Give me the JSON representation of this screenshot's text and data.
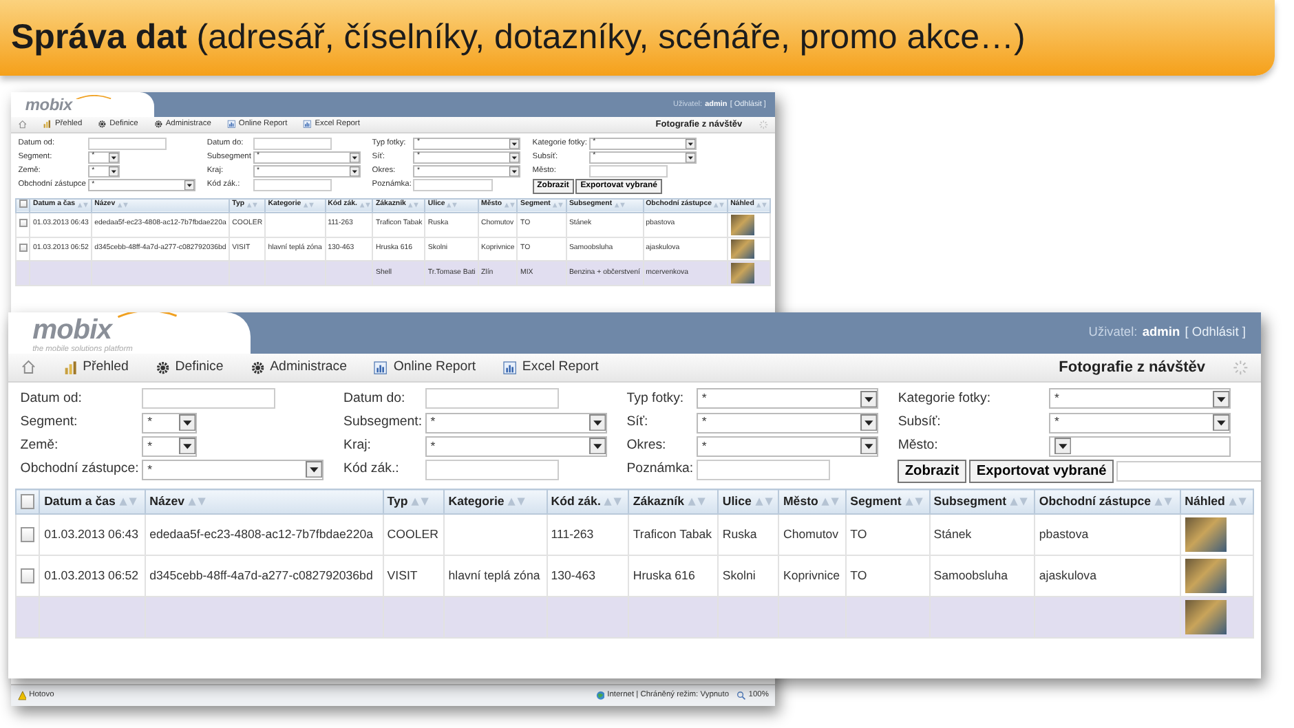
{
  "slide_title": "**Správa dat** (adresář, číselníky, dotazníky, scénáře, promo akce…)",
  "back_screenshot": {
    "logo": "mobix",
    "user_label": "Uživatel:",
    "user_name": "admin",
    "logout": "[ Odhlásit ]",
    "nav": [
      {
        "kind": "home"
      },
      {
        "kind": "chart",
        "label": "Přehled"
      },
      {
        "kind": "gear",
        "label": "Definice"
      },
      {
        "kind": "gear",
        "label": "Administrace"
      },
      {
        "kind": "report",
        "label": "Online Report"
      },
      {
        "kind": "report",
        "label": "Excel Report"
      }
    ],
    "page_title": "Fotografie z návštěv",
    "filter_columns": [
      {
        "items": [
          {
            "kind": "text",
            "label": "Datum od:"
          },
          {
            "kind": "short_select",
            "label": "Segment:",
            "value": "*"
          },
          {
            "kind": "short_select",
            "label": "Země:",
            "value": "*"
          },
          {
            "kind": "select",
            "label": "Obchodní zástupce",
            "value": "*"
          }
        ]
      },
      {
        "items": [
          {
            "kind": "text",
            "label": "Datum do:"
          },
          {
            "kind": "select",
            "label": "Subsegment",
            "value": "*"
          },
          {
            "kind": "select",
            "label": "Kraj:",
            "value": "*"
          },
          {
            "kind": "text",
            "label": "Kód zák.:"
          }
        ]
      },
      {
        "items": [
          {
            "kind": "select",
            "label": "Typ fotky:",
            "value": "*"
          },
          {
            "kind": "select",
            "label": "Síť:",
            "value": "*"
          },
          {
            "kind": "select",
            "label": "Okres:",
            "value": "*"
          },
          {
            "kind": "text",
            "label": "Poznámka:"
          }
        ]
      },
      {
        "items": [
          {
            "kind": "select",
            "label": "Kategorie fotky:",
            "value": "*"
          },
          {
            "kind": "select",
            "label": "Subsíť:",
            "value": "*"
          },
          {
            "kind": "text",
            "label": "Město:"
          },
          {
            "kind": "buttons"
          }
        ]
      }
    ],
    "buttons": [
      "Zobrazit",
      "Exportovat vybrané"
    ],
    "select_all_checked": false,
    "columns": [
      "Datum a čas",
      "Název",
      "Typ",
      "Kategorie",
      "Kód zák.",
      "Zákazník",
      "Ulice",
      "Město",
      "Segment",
      "Subsegment",
      "Obchodní zástupce",
      "Náhled"
    ],
    "rows": [
      {
        "checked": false,
        "highlighted": false,
        "cells": [
          "01.03.2013 06:43",
          "ededaa5f-ec23-4808-ac12-7b7fbdae220a",
          "COOLER",
          null,
          "111-263",
          "Traficon Tabak",
          "Ruska",
          "Chomutov",
          "TO",
          "Stánek",
          "pbastova"
        ]
      },
      {
        "checked": false,
        "highlighted": false,
        "cells": [
          "01.03.2013 06:52",
          "d345cebb-48ff-4a7d-a277-c082792036bd",
          "VISIT",
          "hlavní teplá zóna",
          "130-463",
          "Hruska 616",
          "Skolni",
          "Koprivnice",
          "TO",
          "Samoobsluha",
          "ajaskulova"
        ]
      },
      {
        "checked": null,
        "highlighted": true,
        "cells": [
          null,
          null,
          null,
          null,
          null,
          "Shell",
          "Tr.Tomase Bati",
          "Zlín",
          "MIX",
          "Benzina + občerstvení",
          "mcervenkova"
        ]
      }
    ],
    "status_bar": {
      "left": "Hotovo",
      "zone": "Internet | Chráněný režim: Vypnuto",
      "zoom": "100%"
    }
  },
  "front_screenshot": {
    "logo": "mobix",
    "tagline": "the mobile solutions platform",
    "user_label": "Uživatel:",
    "user_name": "admin",
    "logout": "[ Odhlásit ]",
    "nav": [
      {
        "kind": "home"
      },
      {
        "kind": "chart",
        "label": "Přehled"
      },
      {
        "kind": "gear",
        "label": "Definice"
      },
      {
        "kind": "gear",
        "label": "Administrace"
      },
      {
        "kind": "report",
        "label": "Online Report"
      },
      {
        "kind": "report",
        "label": "Excel Report"
      }
    ],
    "page_title": "Fotografie z návštěv",
    "filter_columns": [
      {
        "items": [
          {
            "kind": "text",
            "label": "Datum od:"
          },
          {
            "kind": "short_select",
            "label": "Segment:",
            "value": "*"
          },
          {
            "kind": "short_select",
            "label": "Země:",
            "value": "*"
          },
          {
            "kind": "select",
            "label": "Obchodní zástupce:",
            "value": "*"
          }
        ]
      },
      {
        "items": [
          {
            "kind": "text",
            "label": "Datum do:"
          },
          {
            "kind": "select",
            "label": "Subsegment:",
            "value": "*"
          },
          {
            "kind": "select",
            "label": "Kraj:",
            "value": "*"
          },
          {
            "kind": "text",
            "label": "Kód zák.:"
          }
        ]
      },
      {
        "items": [
          {
            "kind": "select",
            "label": "Typ fotky:",
            "value": "*"
          },
          {
            "kind": "select",
            "label": "Síť:",
            "value": "*"
          },
          {
            "kind": "select",
            "label": "Okres:",
            "value": "*"
          },
          {
            "kind": "text",
            "label": "Poznámka:"
          }
        ]
      },
      {
        "items": [
          {
            "kind": "select",
            "label": "Kategorie fotky:",
            "value": "*"
          },
          {
            "kind": "select",
            "label": "Subsíť:",
            "value": "*"
          },
          {
            "kind": "select",
            "label": "Město:"
          },
          {
            "kind": "buttons",
            "with_field": true
          }
        ]
      }
    ],
    "buttons": [
      "Zobrazit",
      "Exportovat vybrané"
    ],
    "select_all_checked": false,
    "columns": [
      "Datum a čas",
      "Název",
      "Typ",
      "Kategorie",
      "Kód zák.",
      "Zákazník",
      "Ulice",
      "Město",
      "Segment",
      "Subsegment",
      "Obchodní zástupce",
      "Náhled"
    ],
    "rows": [
      {
        "checked": false,
        "highlighted": false,
        "cells": [
          "01.03.2013 06:43",
          "ededaa5f-ec23-4808-ac12-7b7fbdae220a",
          "COOLER",
          null,
          "111-263",
          "Traficon Tabak",
          "Ruska",
          "Chomutov",
          "TO",
          "Stánek",
          "pbastova"
        ]
      },
      {
        "checked": false,
        "highlighted": false,
        "cells": [
          "01.03.2013 06:52",
          "d345cebb-48ff-4a7d-a277-c082792036bd",
          "VISIT",
          "hlavní teplá zóna",
          "130-463",
          "Hruska 616",
          "Skolni",
          "Koprivnice",
          "TO",
          "Samoobsluha",
          "ajaskulova"
        ]
      },
      {
        "checked": null,
        "highlighted": true,
        "cells": [
          null,
          null,
          null,
          null,
          null,
          null,
          null,
          null,
          null,
          null,
          null
        ]
      }
    ]
  }
}
